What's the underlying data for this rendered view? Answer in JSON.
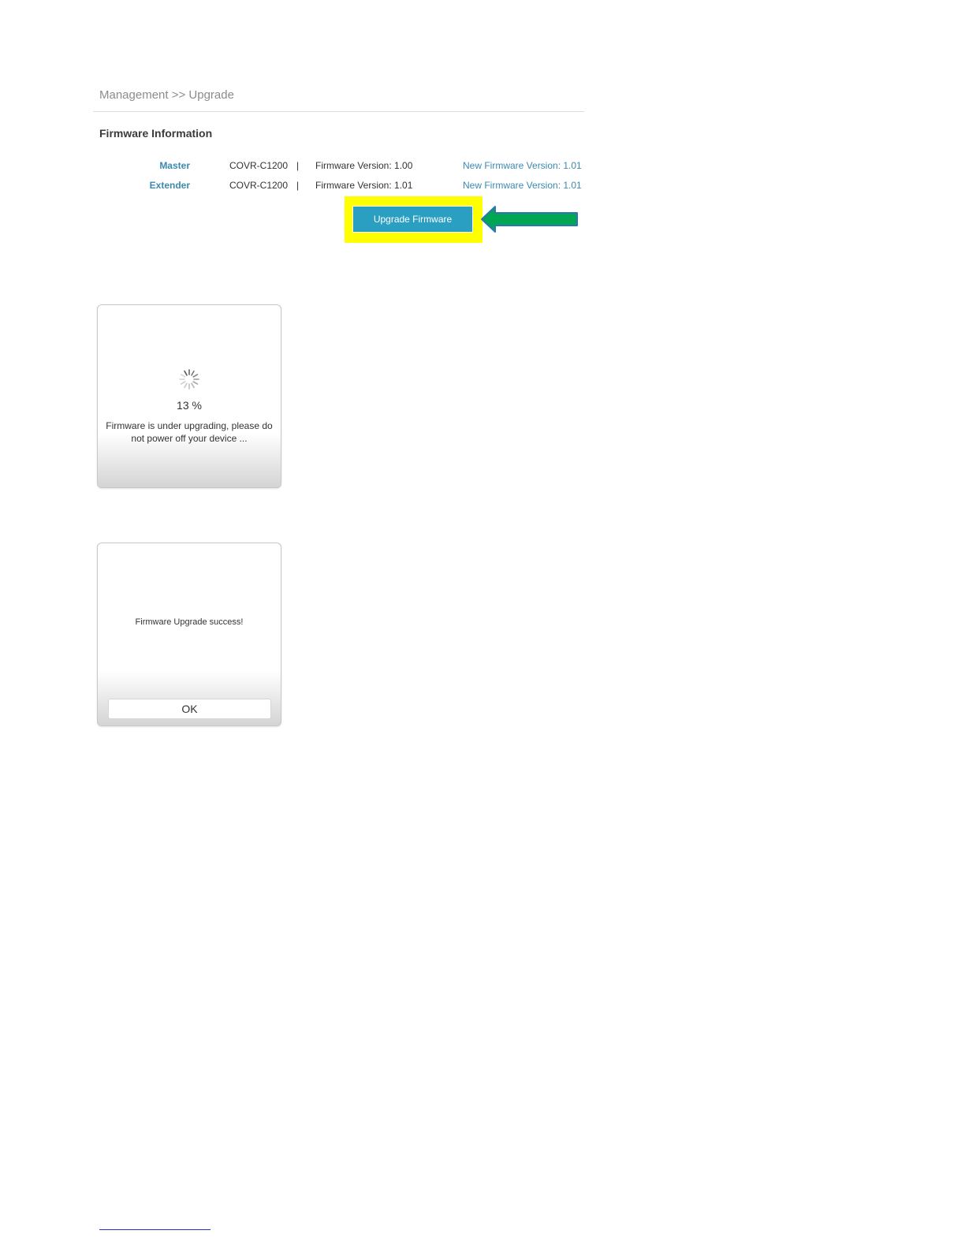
{
  "header": {
    "breadcrumb": "Management >> Upgrade"
  },
  "firmware_info": {
    "title": "Firmware Information",
    "separator": "|",
    "rows": [
      {
        "device": "Master",
        "model": "COVR-C1200",
        "current_version": "Firmware Version: 1.00",
        "new_version": "New Firmware Version: 1.01"
      },
      {
        "device": "Extender",
        "model": "COVR-C1200",
        "current_version": "Firmware Version: 1.01",
        "new_version": "New Firmware Version: 1.01"
      }
    ],
    "upgrade_button_label": "Upgrade Firmware"
  },
  "progress_dialog": {
    "spinner_icon": "loading-spinner-icon",
    "percent": "13 %",
    "message": "Firmware is under upgrading, please do not power off your device ..."
  },
  "success_dialog": {
    "message": "Firmware Upgrade success!",
    "ok_label": "OK"
  },
  "annotations": {
    "arrow_icon": "left-arrow-icon",
    "arrow_color": "#00a651",
    "highlight_color": "#ffff00"
  },
  "colors": {
    "accent": "#2a9fc2",
    "link": "#3b8ab0",
    "text": "#333333",
    "breadcrumb": "#8c8c8c"
  }
}
